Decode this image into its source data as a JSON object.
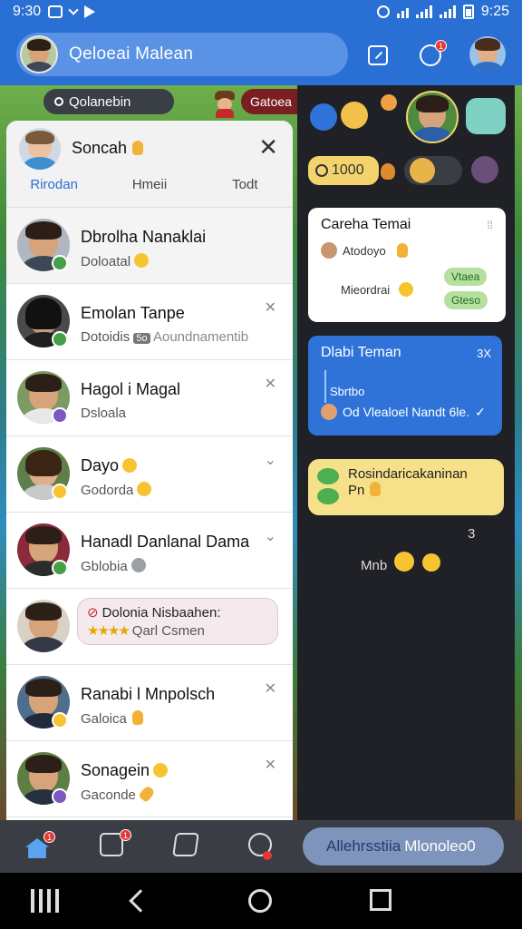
{
  "status_bar": {
    "time_left": "9:30",
    "time_right": "9:25"
  },
  "app_bar": {
    "title": "Qeloeai Malean",
    "notification_badge": "1"
  },
  "scene": {
    "search_pill": "Qolanebin",
    "red_pill": "Gatoea"
  },
  "chat_list": {
    "header_name": "Soncah",
    "tabs": [
      "Rirodan",
      "Hmeii",
      "Todt"
    ],
    "rows": [
      {
        "name": "Dbrolha Nanaklai",
        "sub": "Doloatal",
        "status_color": "#43a047",
        "emoji": true
      },
      {
        "name": "Emolan Tanpe",
        "sub": "Dotoidis",
        "sub_extra": "Aoundnamentib",
        "status_color": "#43a047",
        "badge": "5o"
      },
      {
        "name": "Hagol i Magal",
        "sub": "Dsloala",
        "status_color": "#7e57c2"
      },
      {
        "name": "Dayo",
        "sub": "Godorda",
        "status_color": "#f7c431",
        "emoji": true
      },
      {
        "name": "Hanadl Danlanal Dama",
        "sub": "Gblobia",
        "status_color": "#43a047"
      },
      {
        "quote_title": "Dolonia Nisbaahen:",
        "quote_sub": "Qarl Csmen",
        "stars": "★★★★"
      },
      {
        "name": "Ranabi l Mnpolsch",
        "sub": "Galoica",
        "status_color": "#f7c431"
      },
      {
        "name": "Sonagein",
        "sub": "Gaconde",
        "status_color": "#7e57c2",
        "emoji": true
      }
    ]
  },
  "chat": {
    "coins": "1000",
    "card1": {
      "title": "Careha Temai",
      "line1": "Atodoyo",
      "line2": "Mieordrai",
      "chip1": "Vtaea",
      "chip2": "Gteso"
    },
    "card2": {
      "title": "Dlabi Teman",
      "count": "3X",
      "sub": "Sbrtbo",
      "body": "Od Vlealoel Nandt 6le."
    },
    "card3": {
      "text": "Rosindaricakaninan",
      "text2": "Pn"
    },
    "stamp": "3",
    "reaction_label": "Mnb"
  },
  "bottom_nav": {
    "alert_label": "Allehrsstiia",
    "alert_bold": "Mlonoleo0",
    "badge_home": "1",
    "badge_camera": "1"
  }
}
